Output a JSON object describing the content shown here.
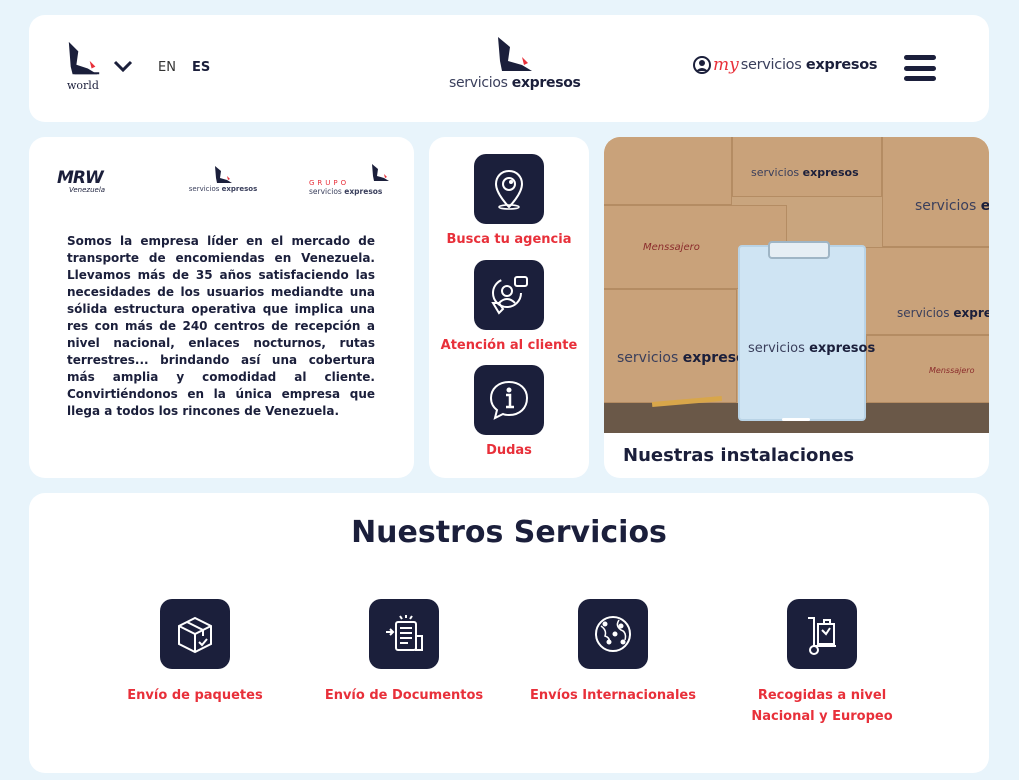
{
  "header": {
    "world_logo_text": "world",
    "lang_en": "EN",
    "lang_es": "ES",
    "logo_text_light": "servicios",
    "logo_text_bold": "expresos",
    "my_text": "my",
    "my_servicios": "servicios",
    "my_expresos": "expresos"
  },
  "partners": {
    "mrw": "MRW",
    "mrw_sub": "Venezuela",
    "sx_light": "servicios",
    "sx_bold": "expresos",
    "grupo_label": "GRUPO",
    "grupo_light": "servicios",
    "grupo_bold": "expresos"
  },
  "about": {
    "text": "Somos la empresa líder en el mercado de transporte de encomiendas en Venezuela. Llevamos más de 35 años satisfaciendo las necesidades de los usuarios mediandte una sólida estructura operativa que implica una res con más de 240 centros de recepción a nivel nacional, enlaces nocturnos, rutas terrestres... brindando así una cobertura más amplia y comodidad al cliente. Convirtiéndonos en la única empresa que llega a todos los rincones de Venezuela."
  },
  "quick_links": [
    {
      "label": "Busca tu agencia",
      "icon": "location-pin-icon"
    },
    {
      "label": "Atención al cliente",
      "icon": "customer-service-icon"
    },
    {
      "label": "Dudas",
      "icon": "info-bubble-icon"
    }
  ],
  "installations": {
    "title": "Nuestras instalaciones",
    "box_light": "servicios",
    "box_bold": "expresos",
    "menssajero": "Menssajero"
  },
  "services": {
    "title": "Nuestros Servicios",
    "items": [
      {
        "label": "Envío de paquetes",
        "icon": "package-icon"
      },
      {
        "label": "Envío de Documentos",
        "icon": "document-icon"
      },
      {
        "label": "Envíos Internacionales",
        "icon": "globe-icon"
      },
      {
        "label_line1": "Recogidas a nivel",
        "label_line2": "Nacional y Europeo",
        "icon": "hand-truck-icon"
      }
    ]
  },
  "colors": {
    "navy": "#1b1f3b",
    "accent_red": "#e8303a",
    "background": "#e8f4fb"
  }
}
